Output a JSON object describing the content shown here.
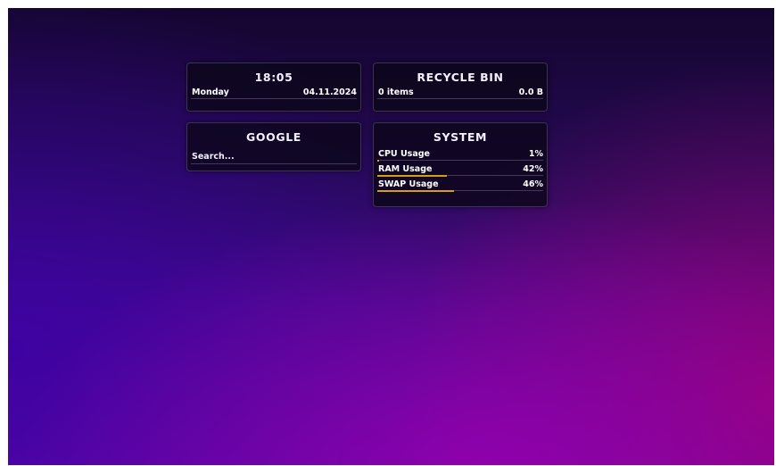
{
  "clock_widget": {
    "time": "18:05",
    "day": "Monday",
    "date": "04.11.2024"
  },
  "recycle_bin_widget": {
    "title": "RECYCLE BIN",
    "items": "0 items",
    "size": "0.0 B"
  },
  "google_widget": {
    "title": "GOOGLE",
    "search_placeholder": "Search..."
  },
  "system_widget": {
    "title": "SYSTEM",
    "meters": [
      {
        "label": "CPU Usage",
        "value": "1%",
        "fraction": 0.01
      },
      {
        "label": "RAM Usage",
        "value": "42%",
        "fraction": 0.42
      },
      {
        "label": "SWAP Usage",
        "value": "46%",
        "fraction": 0.46
      }
    ],
    "meter_color": "#d6a00c"
  }
}
